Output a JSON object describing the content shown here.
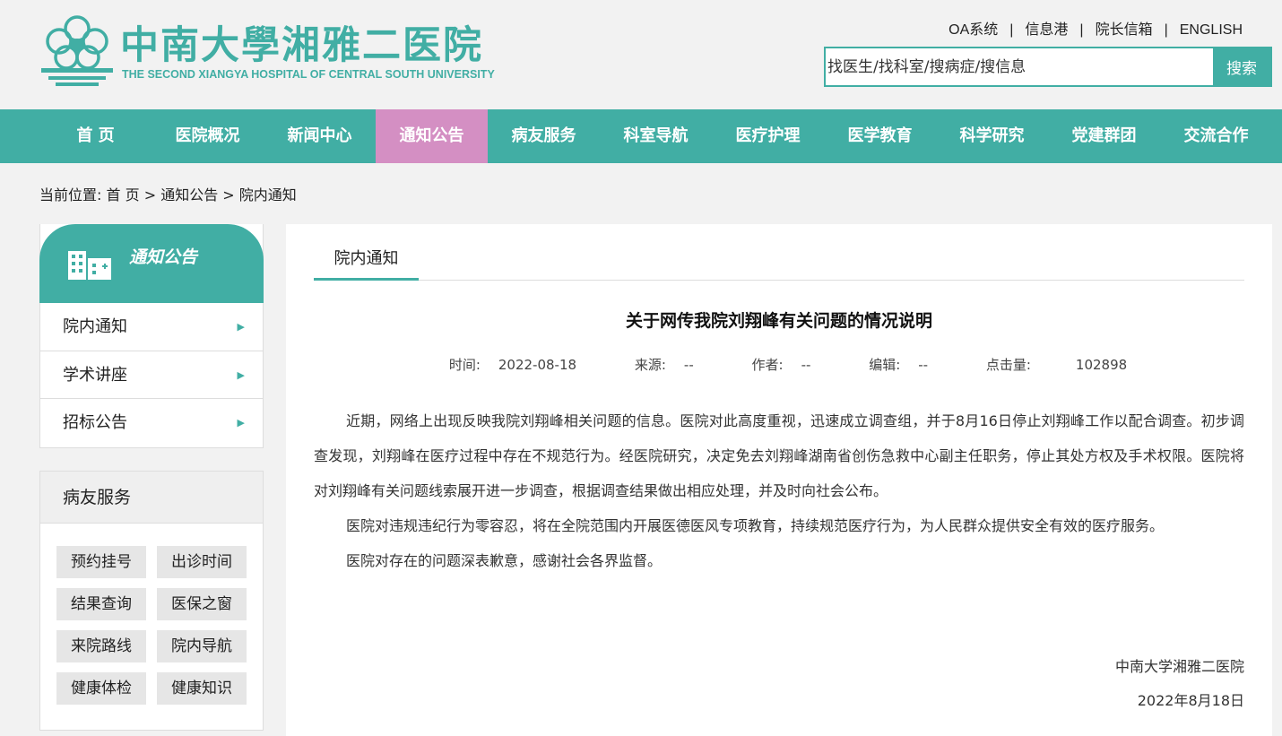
{
  "header": {
    "logo_cn": "中南大學湘雅二医院",
    "logo_en": "THE SECOND XIANGYA HOSPITAL OF CENTRAL SOUTH UNIVERSITY",
    "top_links": [
      "OA系统",
      "信息港",
      "院长信箱",
      "ENGLISH"
    ],
    "search_placeholder": "找医生/找科室/搜病症/搜信息",
    "search_button": "搜索"
  },
  "nav": [
    "首 页",
    "医院概况",
    "新闻中心",
    "通知公告",
    "病友服务",
    "科室导航",
    "医疗护理",
    "医学教育",
    "科学研究",
    "党建群团",
    "交流合作"
  ],
  "nav_active": "通知公告",
  "breadcrumb": {
    "prefix": "当前位置:",
    "items": [
      "首 页",
      "通知公告",
      "院内通知"
    ],
    "separator": ">"
  },
  "sidebar": {
    "title": "通知公告",
    "items": [
      "院内通知",
      "学术讲座",
      "招标公告"
    ],
    "services_title": "病友服务",
    "services": [
      "预约挂号",
      "出诊时间",
      "结果查询",
      "医保之窗",
      "来院路线",
      "院内导航",
      "健康体检",
      "健康知识"
    ]
  },
  "article": {
    "tab": "院内通知",
    "title": "关于网传我院刘翔峰有关问题的情况说明",
    "meta": {
      "time_label": "时间:",
      "time": "2022-08-18",
      "source_label": "来源:",
      "source": "--",
      "author_label": "作者:",
      "author": "--",
      "editor_label": "编辑:",
      "editor": "--",
      "views_label": "点击量:",
      "views": "102898"
    },
    "paragraphs": [
      "近期，网络上出现反映我院刘翔峰相关问题的信息。医院对此高度重视，迅速成立调查组，并于8月16日停止刘翔峰工作以配合调查。初步调查发现，刘翔峰在医疗过程中存在不规范行为。经医院研究，决定免去刘翔峰湖南省创伤急救中心副主任职务，停止其处方权及手术权限。医院将对刘翔峰有关问题线索展开进一步调查，根据调查结果做出相应处理，并及时向社会公布。",
      "医院对违规违纪行为零容忍，将在全院范围内开展医德医风专项教育，持续规范医疗行为，为人民群众提供安全有效的医疗服务。",
      "医院对存在的问题深表歉意，感谢社会各界监督。"
    ],
    "signature": "中南大学湘雅二医院",
    "date": "2022年8月18日"
  },
  "colors": {
    "primary": "#41aea4",
    "active_nav": "#d48fc3"
  }
}
